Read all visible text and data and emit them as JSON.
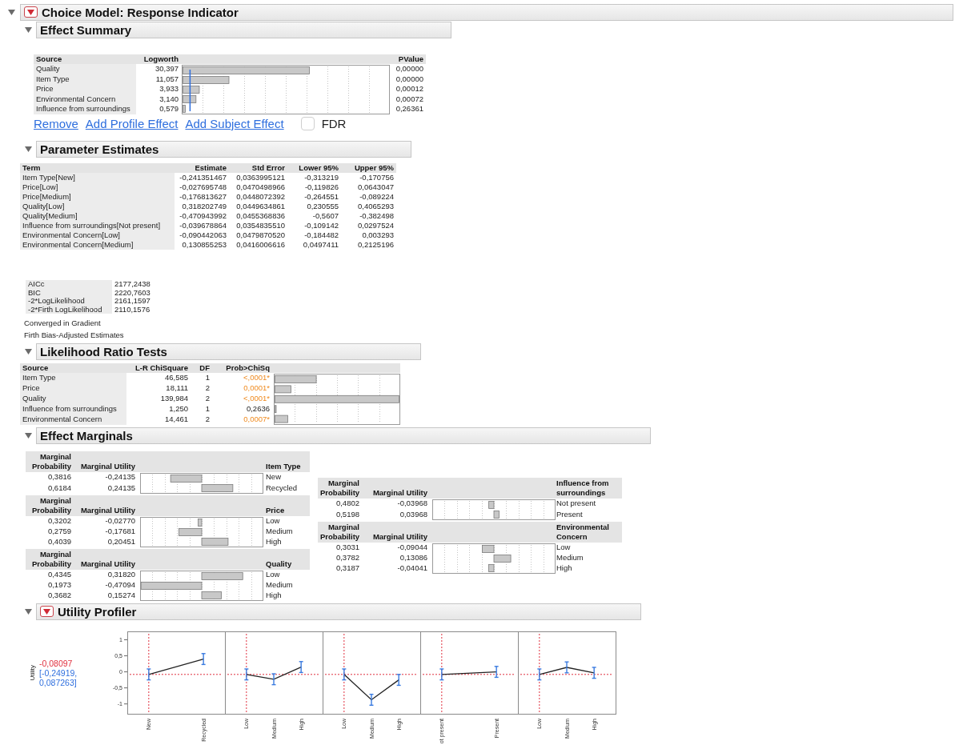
{
  "report": {
    "title": "Choice Model: Response Indicator",
    "expanded": true,
    "hotspot": true
  },
  "sections": [
    {
      "kind": "effect_summary",
      "title": "Effect Summary",
      "expanded": true,
      "hotspot": false,
      "columns": [
        "Source",
        "Logworth",
        "PValue"
      ],
      "rows": [
        {
          "source": "Quality",
          "logworth": "30,397",
          "pvalue": "0,00000"
        },
        {
          "source": "Item Type",
          "logworth": "11,057",
          "pvalue": "0,00000"
        },
        {
          "source": "Price",
          "logworth": "3,933",
          "pvalue": "0,00012"
        },
        {
          "source": "Environmental Concern",
          "logworth": "3,140",
          "pvalue": "0,00072"
        },
        {
          "source": "Influence from surroundings",
          "logworth": "0,579",
          "pvalue": "0,26361"
        }
      ],
      "links": [
        "Remove",
        "Add Profile Effect",
        "Add Subject Effect"
      ],
      "fdr": {
        "label": "FDR",
        "checked": false
      }
    },
    {
      "kind": "parameter_estimates",
      "title": "Parameter Estimates",
      "expanded": true,
      "hotspot": false,
      "columns": [
        "Term",
        "Estimate",
        "Std Error",
        "Lower 95%",
        "Upper 95%"
      ],
      "rows": [
        [
          "Item Type[New]",
          "-0,241351467",
          "0,0363995121",
          "-0,313219",
          "-0,170756"
        ],
        [
          "Price[Low]",
          "-0,027695748",
          "0,0470498966",
          "-0,119826",
          "0,0643047"
        ],
        [
          "Price[Medium]",
          "-0,176813627",
          "0,0448072392",
          "-0,264551",
          "-0,089224"
        ],
        [
          "Quality[Low]",
          "0,318202749",
          "0,0449634861",
          "0,230555",
          "0,4065293"
        ],
        [
          "Quality[Medium]",
          "-0,470943992",
          "0,0455368836",
          "-0,5607",
          "-0,382498"
        ],
        [
          "Influence from surroundings[Not present]",
          "-0,039678864",
          "0,0354835510",
          "-0,109142",
          "0,0297524"
        ],
        [
          "Environmental Concern[Low]",
          "-0,090442063",
          "0,0479870520",
          "-0,184482",
          "0,003293"
        ],
        [
          "Environmental Concern[Medium]",
          "0,130855253",
          "0,0416006616",
          "0,0497411",
          "0,2125196"
        ]
      ],
      "fit_stats": [
        {
          "label": "AICc",
          "value": "2177,2438"
        },
        {
          "label": "BIC",
          "value": "2220,7603"
        },
        {
          "label": "-2*LogLikelihood",
          "value": "2161,1597"
        },
        {
          "label": "-2*Firth LogLikelihood",
          "value": "2110,1576"
        }
      ],
      "notes": [
        "Converged in Gradient",
        "Firth Bias-Adjusted Estimates"
      ]
    },
    {
      "kind": "likelihood_ratio",
      "title": "Likelihood Ratio Tests",
      "expanded": true,
      "hotspot": false,
      "columns": [
        "Source",
        "L-R ChiSquare",
        "DF",
        "Prob>ChiSq"
      ],
      "rows": [
        {
          "source": "Item Type",
          "chisquare": "46,585",
          "df": "1",
          "prob": "<,0001*",
          "significant": true
        },
        {
          "source": "Price",
          "chisquare": "18,111",
          "df": "2",
          "prob": "0,0001*",
          "significant": true
        },
        {
          "source": "Quality",
          "chisquare": "139,984",
          "df": "2",
          "prob": "<,0001*",
          "significant": true
        },
        {
          "source": "Influence from surroundings",
          "chisquare": "1,250",
          "df": "1",
          "prob": "0,2636",
          "significant": false
        },
        {
          "source": "Environmental Concern",
          "chisquare": "14,461",
          "df": "2",
          "prob": "0,0007*",
          "significant": true
        }
      ]
    },
    {
      "kind": "marginals",
      "title": "Effect Marginals",
      "expanded": true,
      "hotspot": false,
      "columns": [
        {
          "groups": [
            {
              "headers": [
                "Marginal Probability",
                "Marginal Utility"
              ],
              "factor": "Item Type",
              "rows": [
                {
                  "probability": "0,3816",
                  "utility": "-0,24135",
                  "label": "New"
                },
                {
                  "probability": "0,6184",
                  "utility": "0,24135",
                  "label": "Recycled"
                }
              ]
            },
            {
              "headers": [
                "Marginal Probability",
                "Marginal Utility"
              ],
              "factor": "Price",
              "rows": [
                {
                  "probability": "0,3202",
                  "utility": "-0,02770",
                  "label": "Low"
                },
                {
                  "probability": "0,2759",
                  "utility": "-0,17681",
                  "label": "Medium"
                },
                {
                  "probability": "0,4039",
                  "utility": "0,20451",
                  "label": "High"
                }
              ]
            },
            {
              "headers": [
                "Marginal Probability",
                "Marginal Utility"
              ],
              "factor": "Quality",
              "rows": [
                {
                  "probability": "0,4345",
                  "utility": "0,31820",
                  "label": "Low"
                },
                {
                  "probability": "0,1973",
                  "utility": "-0,47094",
                  "label": "Medium"
                },
                {
                  "probability": "0,3682",
                  "utility": "0,15274",
                  "label": "High"
                }
              ]
            }
          ]
        },
        {
          "groups": [
            {
              "headers": [
                "Marginal Probability",
                "Marginal Utility"
              ],
              "factor": "Influence from surroundings",
              "rows": [
                {
                  "probability": "0,4802",
                  "utility": "-0,03968",
                  "label": "Not present"
                },
                {
                  "probability": "0,5198",
                  "utility": "0,03968",
                  "label": "Present"
                }
              ]
            },
            {
              "headers": [
                "Marginal Probability",
                "Marginal Utility"
              ],
              "factor": "Environmental Concern",
              "rows": [
                {
                  "probability": "0,3031",
                  "utility": "-0,09044",
                  "label": "Low"
                },
                {
                  "probability": "0,3782",
                  "utility": "0,13086",
                  "label": "Medium"
                },
                {
                  "probability": "0,3187",
                  "utility": "-0,04041",
                  "label": "High"
                }
              ]
            }
          ]
        }
      ]
    },
    {
      "kind": "profiler",
      "title": "Utility Profiler",
      "expanded": true,
      "hotspot": true,
      "utility_label": "Utility",
      "value": "-0,08097",
      "interval": "[-0,24919, 0,087263]",
      "charts": [
        {
          "chart_data": {
            "type": "line",
            "categories": [
              "New",
              "Recycled"
            ],
            "values": [
              -0.08,
              0.4
            ],
            "ylim": [
              -1.32,
              1.25
            ],
            "yticks": [
              {
                "value": 1,
                "label": "1"
              },
              {
                "value": 0.5,
                "label": "0,5"
              },
              {
                "value": 0,
                "label": "0"
              },
              {
                "value": -0.5,
                "label": "-0,5"
              },
              {
                "value": -1,
                "label": "-1"
              }
            ],
            "ref_lines": [
              {
                "axis": "y",
                "value": -0.08
              },
              {
                "axis": "x",
                "value": "New"
              }
            ]
          }
        },
        {
          "chart_data": {
            "type": "line",
            "categories": [
              "Low",
              "Medium",
              "High"
            ],
            "values": [
              -0.08,
              -0.23,
              0.15
            ],
            "ylim": [
              -1.32,
              1.25
            ],
            "ref_lines": [
              {
                "axis": "y",
                "value": -0.08
              },
              {
                "axis": "x",
                "value": "Low"
              }
            ]
          }
        },
        {
          "chart_data": {
            "type": "line",
            "categories": [
              "Low",
              "Medium",
              "High"
            ],
            "values": [
              -0.08,
              -0.87,
              -0.25
            ],
            "ylim": [
              -1.32,
              1.25
            ],
            "ref_lines": [
              {
                "axis": "y",
                "value": -0.08
              },
              {
                "axis": "x",
                "value": "Low"
              }
            ]
          }
        },
        {
          "chart_data": {
            "type": "line",
            "categories": [
              "ot present",
              "Present"
            ],
            "values": [
              -0.08,
              0
            ],
            "ylim": [
              -1.32,
              1.25
            ],
            "ref_lines": [
              {
                "axis": "y",
                "value": -0.08
              },
              {
                "axis": "x",
                "value": "ot present"
              }
            ]
          }
        },
        {
          "chart_data": {
            "type": "line",
            "categories": [
              "Low",
              "Medium",
              "High"
            ],
            "values": [
              -0.08,
              0.14,
              -0.03
            ],
            "ylim": [
              -1.32,
              1.25
            ],
            "ref_lines": [
              {
                "axis": "y",
                "value": -0.08
              },
              {
                "axis": "x",
                "value": "Low"
              }
            ]
          }
        }
      ]
    }
  ]
}
